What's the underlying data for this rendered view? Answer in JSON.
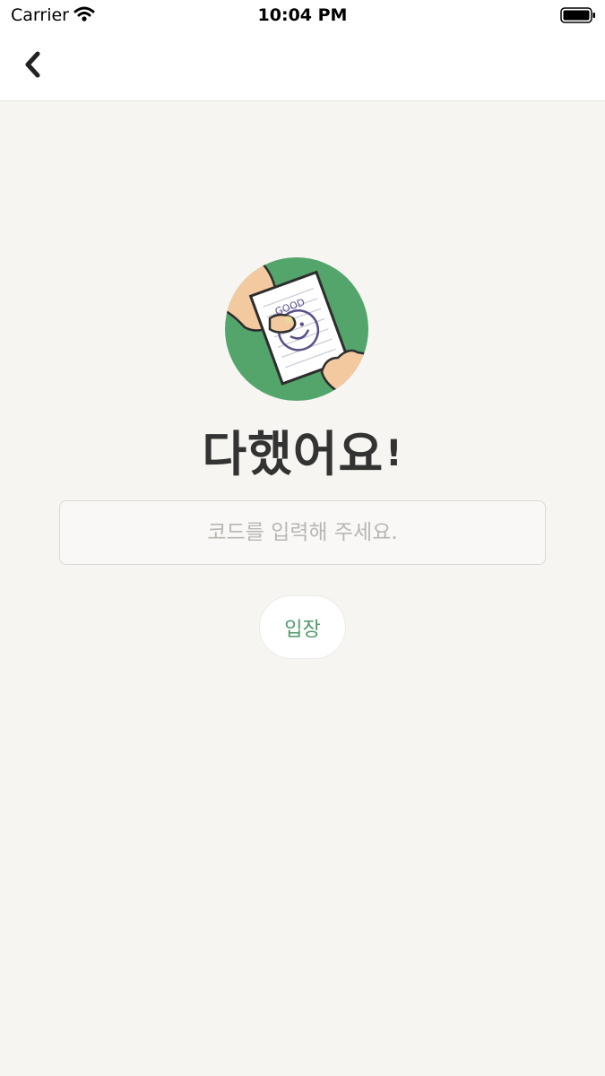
{
  "status_bar": {
    "carrier": "Carrier",
    "time": "10:04 PM",
    "wifi_icon": "wifi-icon",
    "battery_icon": "battery-icon"
  },
  "nav": {
    "back_icon": "chevron-left-icon"
  },
  "hero": {
    "illustration_icon": "good-stamp-paper-illustration",
    "stamp_text": "GOOD",
    "circle_color": "#53a56b"
  },
  "brand": {
    "title": "다했어요",
    "exclamation": "!"
  },
  "form": {
    "code_placeholder": "코드를 입력해 주세요.",
    "code_value": "",
    "enter_label": "입장",
    "accent_color": "#4f9a6a"
  }
}
